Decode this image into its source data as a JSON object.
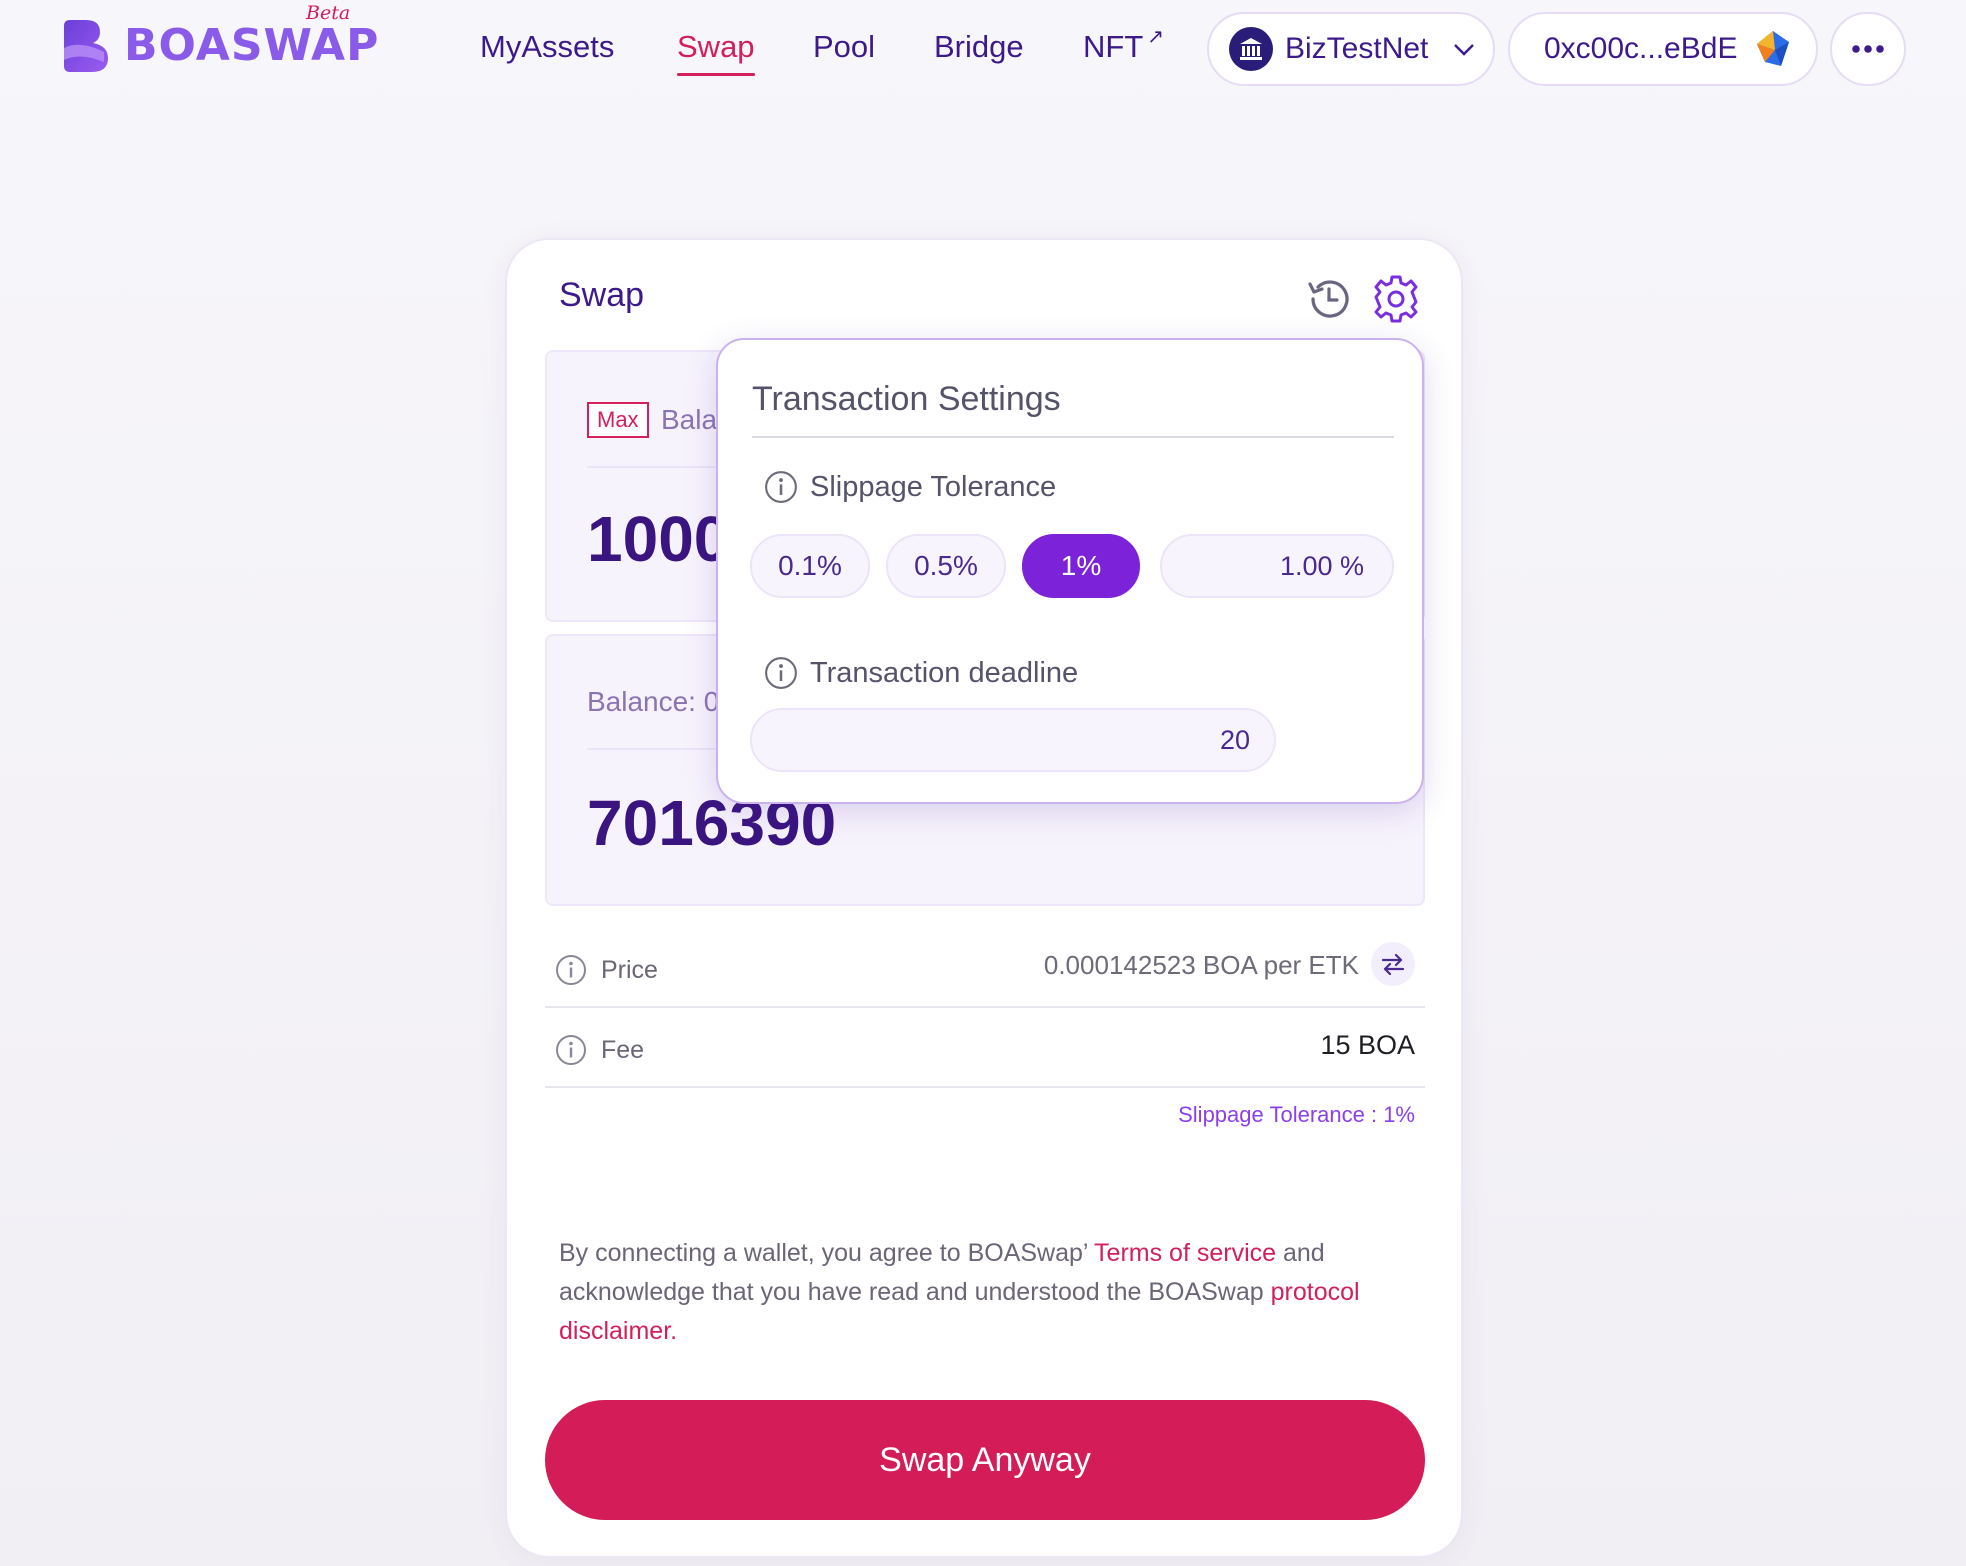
{
  "brand": {
    "name": "BOASWAP",
    "tag": "Beta",
    "accent": "#d3205a",
    "primary": "#3d1a8c"
  },
  "nav": [
    {
      "label": "MyAssets",
      "active": false
    },
    {
      "label": "Swap",
      "active": true
    },
    {
      "label": "Pool",
      "active": false
    },
    {
      "label": "Bridge",
      "active": false
    },
    {
      "label": "NFT",
      "active": false,
      "external": true
    }
  ],
  "network": {
    "label": "BizTestNet",
    "icon": "bank-icon"
  },
  "wallet": {
    "address": "0xc00c...eBdE",
    "icon": "wallet-avatar-icon"
  },
  "more": {
    "icon": "more-dots-icon"
  },
  "swap": {
    "title": "Swap",
    "from": {
      "max_label": "Max",
      "balance_text": "Bala",
      "amount": "1000"
    },
    "to": {
      "balance_text": "Balance: 0",
      "amount": "7016390"
    },
    "price": {
      "label": "Price",
      "value": "0.000142523 BOA per ETK"
    },
    "fee": {
      "label": "Fee",
      "value": "15 BOA"
    },
    "slippage_note": "Slippage Tolerance : 1%",
    "disclaimer": {
      "part1": "By connecting a wallet, you agree to BOASwap’ ",
      "terms": "Terms of service",
      "part2": " and acknowledge that you have read and understood the BOASwap ",
      "protocol": "protocol disclaimer",
      "part3": "."
    },
    "button_label": "Swap Anyway"
  },
  "settings": {
    "title": "Transaction Settings",
    "slippage_label": "Slippage Tolerance",
    "options": [
      {
        "label": "0.1%",
        "active": false
      },
      {
        "label": "0.5%",
        "active": false
      },
      {
        "label": "1%",
        "active": true
      }
    ],
    "custom_value": "1.00 %",
    "deadline_label": "Transaction deadline",
    "deadline_value": "20"
  }
}
